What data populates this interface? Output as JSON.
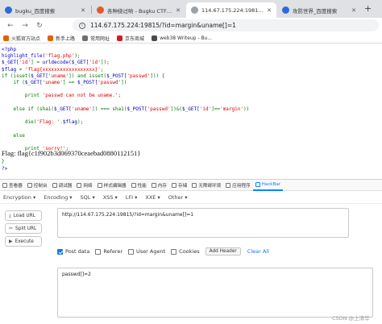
{
  "tabs": [
    {
      "label": "bugku_百度搜索",
      "color": "#2f6bd8",
      "active": false
    },
    {
      "label": "各种绕过哟 - Bugku CTF平台",
      "color": "#e25b2c",
      "active": false
    },
    {
      "label": "114.67.175.224:19815/?id=margin",
      "color": "#9aa0a6",
      "active": true
    },
    {
      "label": "攻防世界_百度搜索",
      "color": "#2f6bd8",
      "active": false
    }
  ],
  "address": {
    "url": "114.67.175.224:19815/?id=margin&uname[]=1"
  },
  "bookmarks": [
    {
      "label": "火狐官方站点",
      "color": "#e66000"
    },
    {
      "label": "新手上路",
      "color": "#e66000"
    },
    {
      "label": "常用网址",
      "color": "#6d6d6d"
    },
    {
      "label": "京东商城",
      "color": "#d71a21"
    },
    {
      "label": "web38 Writeup - Bu...",
      "color": "#4a4a4a"
    }
  ],
  "code_lines": [
    {
      "parts": [
        {
          "t": "<?php",
          "c": "def"
        }
      ]
    },
    {
      "parts": [
        {
          "t": "highlight_file(",
          "c": "def"
        },
        {
          "t": "'flag.php'",
          "c": "str"
        },
        {
          "t": ");",
          "c": "kw"
        }
      ]
    },
    {
      "parts": [
        {
          "t": "$_GET[",
          "c": "def"
        },
        {
          "t": "'id'",
          "c": "str"
        },
        {
          "t": "] = ",
          "c": "kw"
        },
        {
          "t": "urldecode(",
          "c": "def"
        },
        {
          "t": "$_GET[",
          "c": "def"
        },
        {
          "t": "'id'",
          "c": "str"
        },
        {
          "t": "]);",
          "c": "kw"
        }
      ]
    },
    {
      "parts": [
        {
          "t": "$flag ",
          "c": "def"
        },
        {
          "t": "= ",
          "c": "kw"
        },
        {
          "t": "'flag{xxxxxxxxxxxxxxxxxx}'",
          "c": "str"
        },
        {
          "t": ";",
          "c": "kw"
        }
      ]
    },
    {
      "parts": [
        {
          "t": "if ",
          "c": "kw"
        },
        {
          "t": "(isset(",
          "c": "kw"
        },
        {
          "t": "$_GET[",
          "c": "def"
        },
        {
          "t": "'uname'",
          "c": "str"
        },
        {
          "t": "]) ",
          "c": "kw"
        },
        {
          "t": "and ",
          "c": "kw"
        },
        {
          "t": "isset(",
          "c": "kw"
        },
        {
          "t": "$_POST[",
          "c": "def"
        },
        {
          "t": "'passwd'",
          "c": "str"
        },
        {
          "t": "])) {",
          "c": "kw"
        }
      ]
    },
    {
      "parts": [
        {
          "t": "    if ",
          "c": "kw"
        },
        {
          "t": "(",
          "c": "kw"
        },
        {
          "t": "$_GET[",
          "c": "def"
        },
        {
          "t": "'uname'",
          "c": "str"
        },
        {
          "t": "] == ",
          "c": "kw"
        },
        {
          "t": "$_POST[",
          "c": "def"
        },
        {
          "t": "'passwd'",
          "c": "str"
        },
        {
          "t": "])",
          "c": "kw"
        }
      ]
    },
    {
      "parts": [
        {
          "t": " ",
          "c": "kw"
        }
      ]
    },
    {
      "parts": [
        {
          "t": "        print ",
          "c": "kw"
        },
        {
          "t": "'passwd can not be uname.'",
          "c": "str"
        },
        {
          "t": ";",
          "c": "kw"
        }
      ]
    },
    {
      "parts": [
        {
          "t": " ",
          "c": "kw"
        }
      ]
    },
    {
      "parts": [
        {
          "t": "    else if ",
          "c": "kw"
        },
        {
          "t": "(sha1(",
          "c": "kw"
        },
        {
          "t": "$_GET[",
          "c": "def"
        },
        {
          "t": "'uname'",
          "c": "str"
        },
        {
          "t": "]) === ",
          "c": "kw"
        },
        {
          "t": "sha1(",
          "c": "kw"
        },
        {
          "t": "$_POST[",
          "c": "def"
        },
        {
          "t": "'passwd'",
          "c": "str"
        },
        {
          "t": "])&(",
          "c": "kw"
        },
        {
          "t": "$_GET[",
          "c": "def"
        },
        {
          "t": "'id'",
          "c": "str"
        },
        {
          "t": "]==",
          "c": "kw"
        },
        {
          "t": "'margin'",
          "c": "str"
        },
        {
          "t": "))",
          "c": "kw"
        }
      ]
    },
    {
      "parts": [
        {
          "t": " ",
          "c": "kw"
        }
      ]
    },
    {
      "parts": [
        {
          "t": "        die(",
          "c": "kw"
        },
        {
          "t": "'Flag: '",
          "c": "str"
        },
        {
          "t": ".",
          "c": "kw"
        },
        {
          "t": "$flag",
          "c": "def"
        },
        {
          "t": ");",
          "c": "kw"
        }
      ]
    },
    {
      "parts": [
        {
          "t": " ",
          "c": "kw"
        }
      ]
    },
    {
      "parts": [
        {
          "t": "    else",
          "c": "kw"
        }
      ]
    },
    {
      "parts": [
        {
          "t": " ",
          "c": "kw"
        }
      ]
    },
    {
      "parts": [
        {
          "t": "        print ",
          "c": "kw"
        },
        {
          "t": "'sorry!'",
          "c": "str"
        },
        {
          "t": ";",
          "c": "kw"
        }
      ]
    },
    {
      "parts": [
        {
          "t": " ",
          "c": "kw"
        }
      ]
    },
    {
      "parts": [
        {
          "t": "}",
          "c": "kw"
        }
      ]
    },
    {
      "parts": [
        {
          "t": "?> ",
          "c": "def"
        }
      ]
    }
  ],
  "flag_output": "Flag: flag{c1f902b3d069370ceaebad0880112151}",
  "devtools": {
    "tabs": [
      {
        "label": "查看器",
        "active": false
      },
      {
        "label": "控制台",
        "active": false
      },
      {
        "label": "调试器",
        "active": false
      },
      {
        "label": "网络",
        "active": false
      },
      {
        "label": "样式编辑器",
        "active": false
      },
      {
        "label": "性能",
        "active": false
      },
      {
        "label": "内存",
        "active": false
      },
      {
        "label": "存储",
        "active": false
      },
      {
        "label": "无障碍环境",
        "active": false
      },
      {
        "label": "应用程序",
        "active": false
      },
      {
        "label": "HackBar",
        "active": true
      }
    ]
  },
  "hackbar": {
    "menu": [
      "Encryption ▾",
      "Encoding ▾",
      "SQL ▾",
      "XSS ▾",
      "LFI ▾",
      "XXE ▾",
      "Other ▾"
    ],
    "load_url": "Load URL",
    "split_url": "Split URL",
    "execute": "Execute",
    "url_value": "http://114.67.175.224:19815/?id=margin&uname[]=1",
    "options": [
      {
        "label": "Post data",
        "checked": true
      },
      {
        "label": "Referer",
        "checked": false
      },
      {
        "label": "User Agent",
        "checked": false
      },
      {
        "label": "Cookies",
        "checked": false
      }
    ],
    "add_header": "Add Header",
    "clear_all": "Clear All",
    "post_body": "passwd[]=2"
  },
  "watermark": "CSDN @上清华"
}
